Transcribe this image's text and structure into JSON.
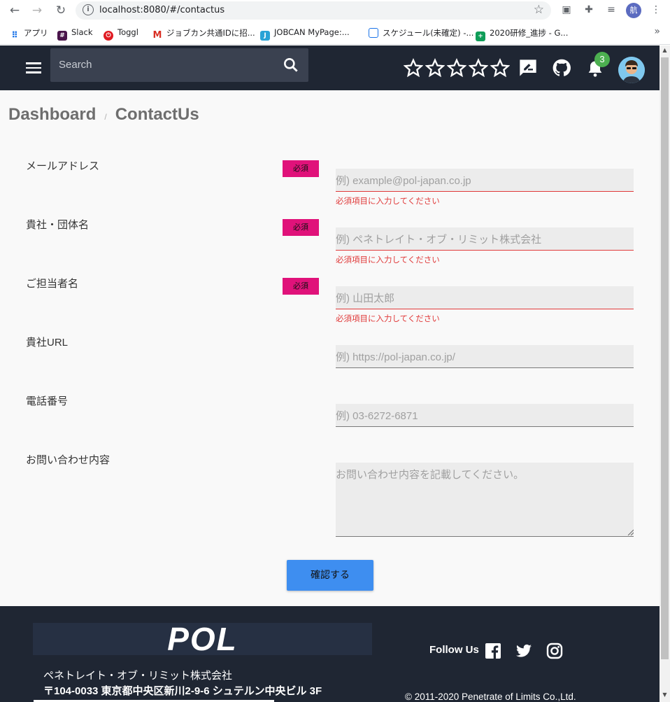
{
  "browser": {
    "url": "localhost:8080/#/contactus",
    "profile_initial": "航",
    "bookmarks": [
      {
        "label": "アプリ"
      },
      {
        "label": "Slack"
      },
      {
        "label": "Toggl"
      },
      {
        "label": "ジョブカン共通IDに招..."
      },
      {
        "label": "JOBCAN MyPage:..."
      },
      {
        "label": "スケジュール(未確定) -..."
      },
      {
        "label": "2020研修_進捗 - G..."
      }
    ],
    "more": "»"
  },
  "header": {
    "search_placeholder": "Search",
    "notification_count": "3",
    "icons": [
      "star-outline-icon",
      "star-outline-icon",
      "star-outline-icon",
      "star-outline-icon",
      "star-outline-icon",
      "feedback-icon",
      "github-icon",
      "bell-icon"
    ]
  },
  "breadcrumb": {
    "root": "Dashboard",
    "separator": "/",
    "current": "ContactUs"
  },
  "form": {
    "required_label": "必須",
    "error_message": "必須項目に入力してください",
    "fields": [
      {
        "label": "メールアドレス",
        "placeholder": "例) example@pol-japan.co.jp",
        "required": true
      },
      {
        "label": "貴社・団体名",
        "placeholder": "例) ペネトレイト・オブ・リミット株式会社",
        "required": true
      },
      {
        "label": "ご担当者名",
        "placeholder": "例) 山田太郎",
        "required": true
      },
      {
        "label": "貴社URL",
        "placeholder": "例) https://pol-japan.co.jp/",
        "required": false
      },
      {
        "label": "電話番号",
        "placeholder": "例) 03-6272-6871",
        "required": false
      },
      {
        "label": "お問い合わせ内容",
        "placeholder": "お問い合わせ内容を記載してください。",
        "required": false
      }
    ],
    "submit_label": "確認する"
  },
  "footer": {
    "logo": "POL",
    "company": "ペネトレイト・オブ・リミット株式会社",
    "address": "〒104-0033 東京都中央区新川2-9-6 シュテルン中央ビル 3F",
    "follow": "Follow Us",
    "social": [
      "facebook-icon",
      "twitter-icon",
      "instagram-icon"
    ],
    "copyright": "© 2011-2020 Penetrate of Limits Co.,Ltd."
  }
}
